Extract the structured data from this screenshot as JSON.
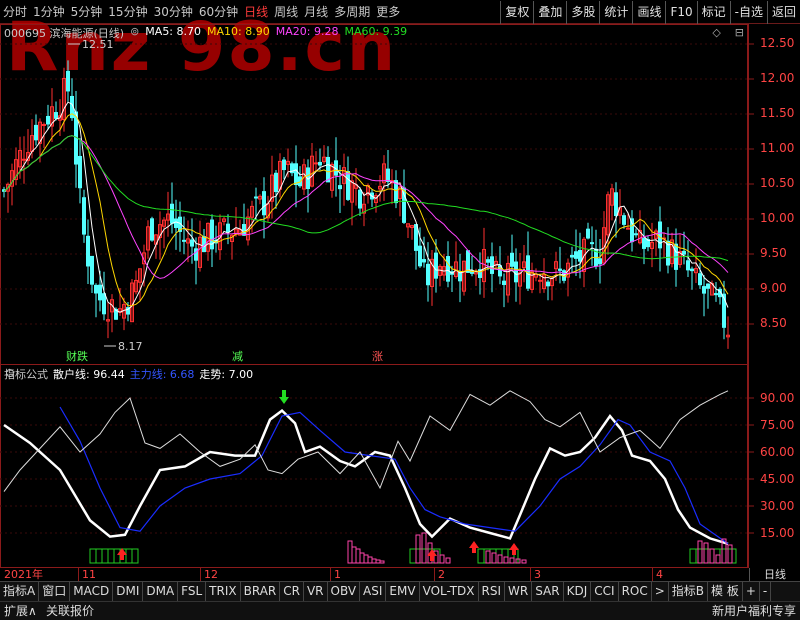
{
  "toolbar": {
    "periods": [
      "分时",
      "1分钟",
      "5分钟",
      "15分钟",
      "30分钟",
      "60分钟",
      "日线",
      "周线",
      "月线",
      "多周期",
      "更多"
    ],
    "selected_index": 6,
    "tools": [
      "复权",
      "叠加",
      "多股",
      "统计",
      "画线",
      "F10",
      "标记",
      "-自选",
      "返回"
    ]
  },
  "watermark": "Rnz 98.cn",
  "kline_header": {
    "code": "000695 滨海能源(日线)",
    "ma5": "MA5: 8.70",
    "ma10": "MA10: 8.90",
    "ma20": "MA20: 9.28",
    "ma60": "MA60: 9.39",
    "icon": "chart-settings-icon"
  },
  "corner_icons": [
    "◇",
    "⊟"
  ],
  "price_axis": [
    "12.50",
    "12.00",
    "11.50",
    "11.00",
    "10.50",
    "10.00",
    "9.50",
    "9.00",
    "8.50"
  ],
  "price_marks": {
    "high": "12.51",
    "low": "8.17"
  },
  "signals": [
    {
      "text": "财跌",
      "color": "#55ff55"
    },
    {
      "text": "减",
      "color": "#55ff55"
    },
    {
      "text": "涨",
      "color": "#ff5555"
    }
  ],
  "indicator_header": {
    "name": "指标公式",
    "retail": "散户线: 96.44",
    "main": "主力线: 6.68",
    "trend": "走势: 7.00"
  },
  "indicator_axis": [
    "90.00",
    "75.00",
    "60.00",
    "45.00",
    "30.00",
    "15.00"
  ],
  "date_axis": {
    "year": "2021年",
    "months": [
      "11",
      "12",
      "1",
      "2",
      "3",
      "4"
    ],
    "period_label": "日线"
  },
  "tabs": [
    "指标A",
    "窗口",
    "MACD",
    "DMI",
    "DMA",
    "FSL",
    "TRIX",
    "BRAR",
    "CR",
    "VR",
    "OBV",
    "ASI",
    "EMV",
    "VOL-TDX",
    "RSI",
    "WR",
    "SAR",
    "KDJ",
    "CCI",
    "ROC",
    ">",
    "指标B",
    "模 板",
    "+",
    "-"
  ],
  "status": {
    "left": "扩展∧",
    "quote": "关联报价",
    "right": "新用户福利专享"
  },
  "colors": {
    "up": "#ff3030",
    "down": "#54ffff",
    "ma5": "#ffffff",
    "ma10": "#ffd700",
    "ma20": "#ff44ff",
    "ma60": "#22dd22",
    "frame": "#8b1a1a"
  }
}
